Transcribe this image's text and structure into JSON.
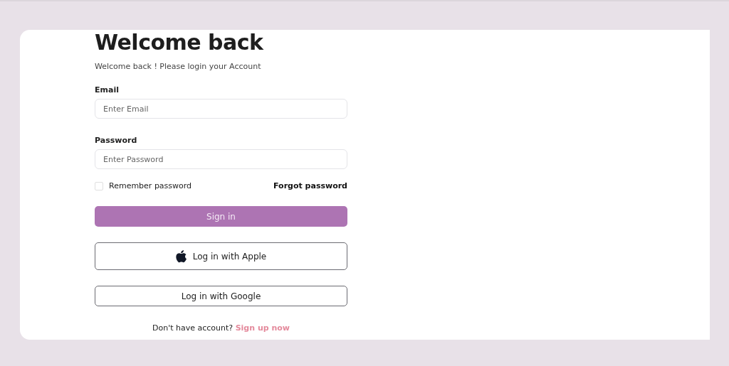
{
  "title": "Welcome back",
  "subtitle": "Welcome back ! Please login your Account",
  "fields": [
    {
      "label": "Email",
      "placeholder": "Enter Email"
    },
    {
      "label": "Password",
      "placeholder": "Enter Password"
    }
  ],
  "remember": {
    "label": "Remember password",
    "checked": false
  },
  "forgot": "Forgot password",
  "submit": "Sign in",
  "social": [
    {
      "kind": "apple",
      "label": "Log in with Apple"
    },
    {
      "kind": "plain",
      "label": "Log in with Google"
    }
  ],
  "footer": {
    "text": "Don't have account?",
    "link": "Sign up now"
  }
}
